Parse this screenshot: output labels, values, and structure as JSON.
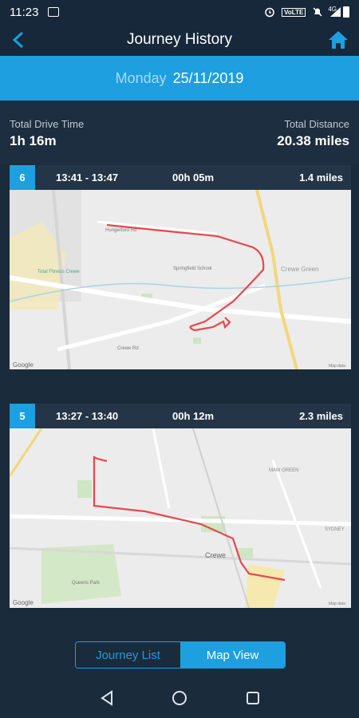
{
  "status_bar": {
    "time": "11:23",
    "network_badge": "VoLTE",
    "signal": "4G"
  },
  "header": {
    "title": "Journey History",
    "back_icon": "back-arrow-icon",
    "home_icon": "home-icon"
  },
  "date_bar": {
    "day": "Monday",
    "date": "25/11/2019"
  },
  "totals": {
    "drive_time_label": "Total Drive Time",
    "drive_time_value": "1h 16m",
    "distance_label": "Total Distance",
    "distance_value": "20.38 miles"
  },
  "journeys": [
    {
      "number": "6",
      "time_range": "13:41 - 13:47",
      "duration": "00h 05m",
      "distance": "1.4 miles",
      "map_labels": [
        "Hungerford Rd",
        "Springfield School",
        "Crewe Green",
        "Total Fitness Crewe",
        "Crewe Rd",
        "Google",
        "Map data"
      ]
    },
    {
      "number": "5",
      "time_range": "13:27 - 13:40",
      "duration": "00h 12m",
      "distance": "2.3 miles",
      "map_labels": [
        "MAW GREEN",
        "Crewe",
        "Queens Park",
        "SYDNEY",
        "Google",
        "Map data"
      ]
    }
  ],
  "view_toggle": {
    "list_label": "Journey List",
    "map_label": "Map View",
    "selected": "Map View"
  },
  "colors": {
    "background": "#1a2b3c",
    "accent": "#1d9fe0",
    "route": "#e8474c"
  }
}
